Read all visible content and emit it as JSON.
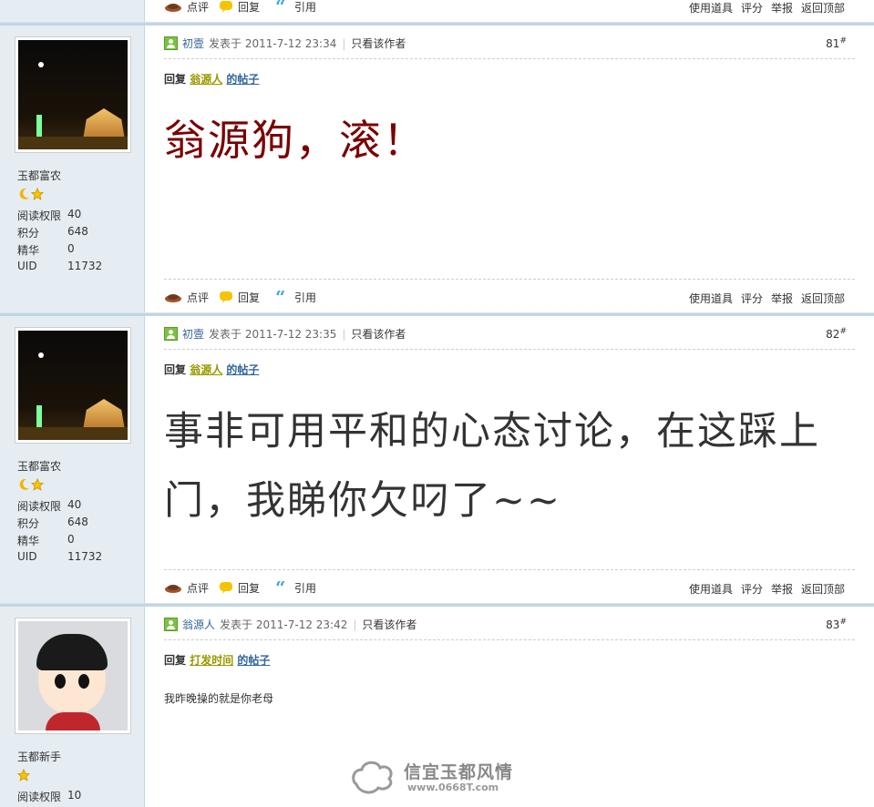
{
  "colors": {
    "sidebar_bg": "#e5edf2",
    "separator": "#c2d5e3",
    "reply_name": "#999900",
    "link": "#336699",
    "big_red": "#7a0000"
  },
  "actions": {
    "comment": "点评",
    "reply": "回复",
    "quote": "引用",
    "use_tool": "使用道具",
    "rate": "评分",
    "report": "举报",
    "back_top": "返回顶部"
  },
  "posts": [
    {
      "floor": "81",
      "floor_mark": "#",
      "author": "初壹",
      "posted_prefix": "发表于",
      "datetime": "2011-7-12 23:34",
      "only_author": "只看该作者",
      "user": {
        "title": "玉都富农",
        "stat_labels": [
          "阅读权限",
          "积分",
          "精华",
          "UID"
        ],
        "stat_values": [
          "40",
          "648",
          "0",
          "11732"
        ]
      },
      "reply_prefix": "回复",
      "reply_to": "翁源人",
      "reply_suffix": "的帖子",
      "content": "翁源狗，滚！"
    },
    {
      "floor": "82",
      "floor_mark": "#",
      "author": "初壹",
      "posted_prefix": "发表于",
      "datetime": "2011-7-12 23:35",
      "only_author": "只看该作者",
      "user": {
        "title": "玉都富农",
        "stat_labels": [
          "阅读权限",
          "积分",
          "精华",
          "UID"
        ],
        "stat_values": [
          "40",
          "648",
          "0",
          "11732"
        ]
      },
      "reply_prefix": "回复",
      "reply_to": "翁源人",
      "reply_suffix": "的帖子",
      "content": "事非可用平和的心态讨论，在这踩上门，我睇你欠叼了~~"
    },
    {
      "floor": "83",
      "floor_mark": "#",
      "author": "翁源人",
      "posted_prefix": "发表于",
      "datetime": "2011-7-12 23:42",
      "only_author": "只看该作者",
      "user": {
        "title": "玉都新手",
        "stat_labels": [
          "阅读权限"
        ],
        "stat_values": [
          "10"
        ]
      },
      "reply_prefix": "回复",
      "reply_to": "打发时间",
      "reply_suffix": "的帖子",
      "content": "我昨晚操的就是你老母"
    }
  ],
  "watermark": {
    "site_name": "信宜玉都风情",
    "url": "www.0668T.com"
  }
}
